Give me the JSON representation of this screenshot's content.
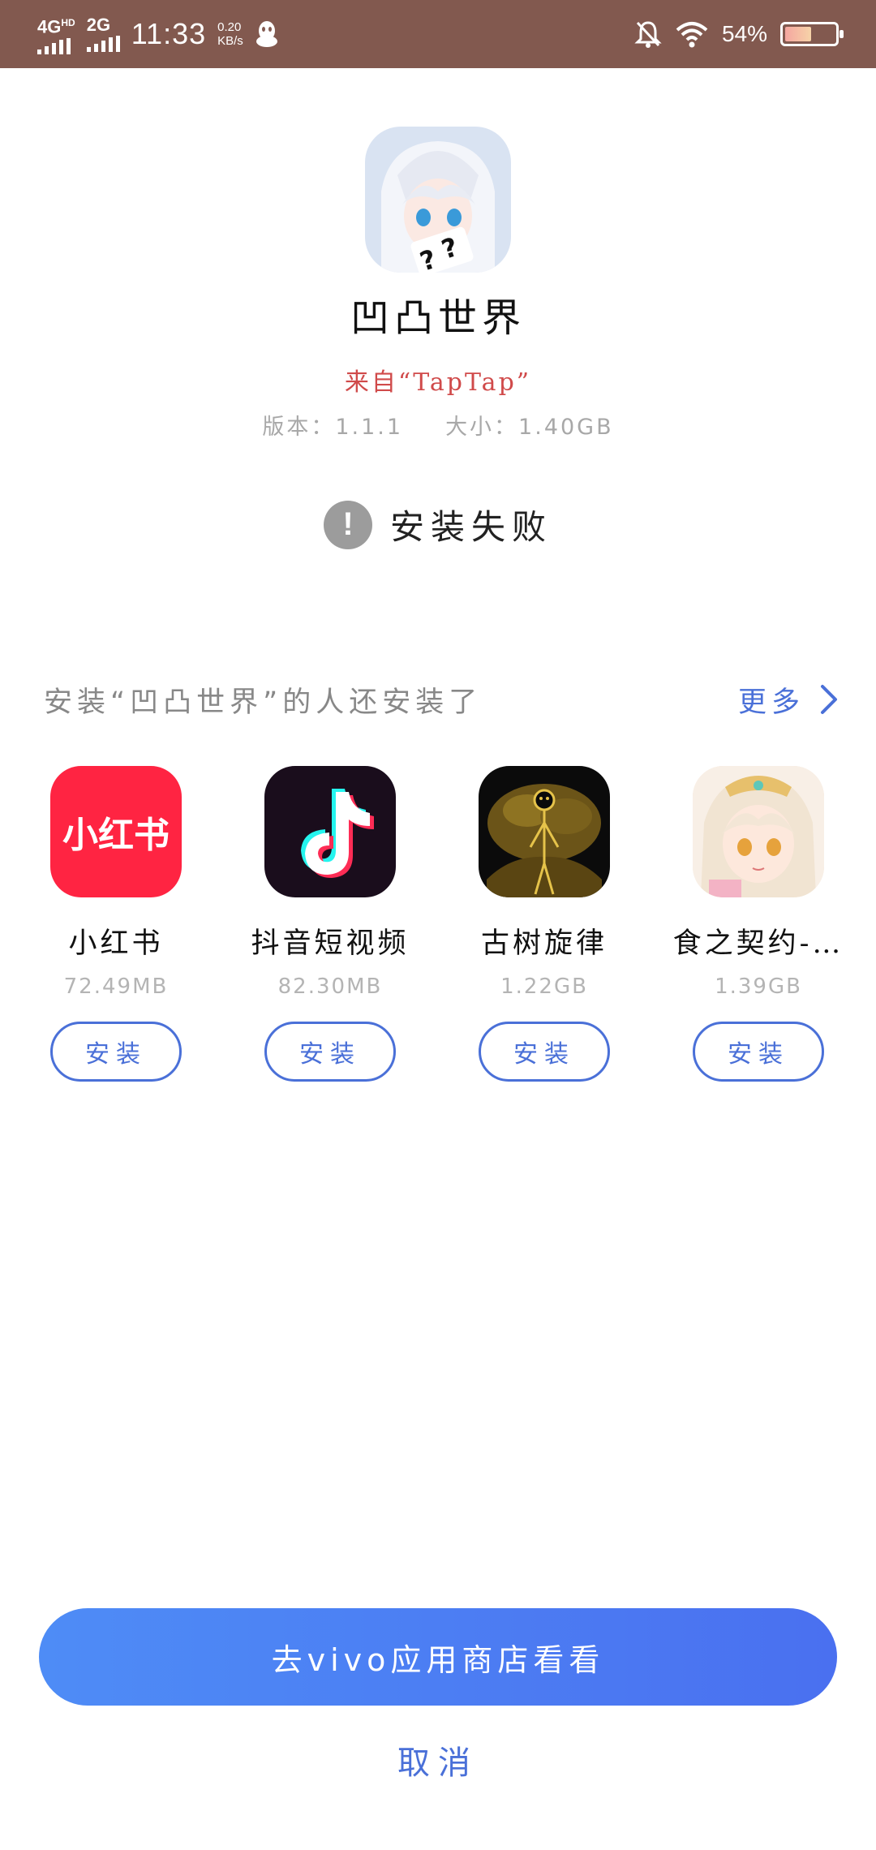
{
  "status_bar": {
    "network1": "4G",
    "network1_sup": "HD",
    "network2": "2G",
    "time": "11:33",
    "speed_value": "0.20",
    "speed_unit": "KB/s",
    "battery_text": "54%",
    "battery_level": 0.54,
    "icons": [
      "qq-icon",
      "mute-bell-icon",
      "wifi-icon",
      "battery-icon"
    ]
  },
  "app": {
    "name": "凹凸世界",
    "source": "来自“TapTap”",
    "version": "版本：1.1.1",
    "size": "大小：1.40GB"
  },
  "status": {
    "icon_glyph": "!",
    "message": "安装失败"
  },
  "recommend": {
    "title": "安装“凹凸世界”的人还安装了",
    "more_label": "更多",
    "items": [
      {
        "name": "小红书",
        "size": "72.49MB",
        "install_label": "安装",
        "icon_text": "小红书",
        "icon_color": "#ff2442"
      },
      {
        "name": "抖音短视频",
        "size": "82.30MB",
        "install_label": "安装",
        "icon": "tiktok-icon",
        "icon_color": "#1a0d1c"
      },
      {
        "name": "古树旋律",
        "size": "1.22GB",
        "install_label": "安装",
        "icon": "tree-figure-icon",
        "icon_color": "#0b0b0b"
      },
      {
        "name": "食之契约-…",
        "size": "1.39GB",
        "install_label": "安装",
        "icon": "anime-girl-icon",
        "icon_color": "#f4e2d0"
      }
    ]
  },
  "actions": {
    "store_label": "去vivo应用商店看看",
    "cancel_label": "取消"
  },
  "colors": {
    "status_bar": "#82594f",
    "accent": "#4a70d8",
    "source_red": "#d04a4a",
    "button_gradient_start": "#4e8cf6",
    "button_gradient_end": "#4a70f0"
  }
}
